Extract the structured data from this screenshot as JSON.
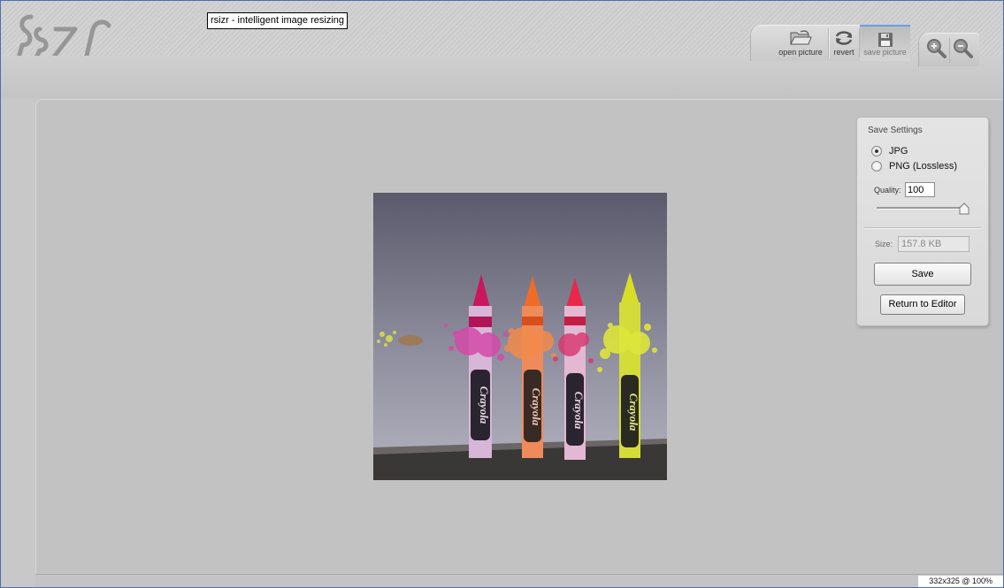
{
  "app": {
    "tooltip": "rsizr - intelligent image resizing",
    "logo_icon": "rszr-logo"
  },
  "toolbar": {
    "open_label": "open picture",
    "revert_label": "revert",
    "save_label": "save picture",
    "open_icon": "folder-open-icon",
    "revert_icon": "revert-icon",
    "save_icon": "floppy-disk-icon",
    "zoom_in_icon": "zoom-in-icon",
    "zoom_out_icon": "zoom-out-icon"
  },
  "save_panel": {
    "title": "Save Settings",
    "formats": [
      {
        "label": "JPG",
        "selected": true
      },
      {
        "label": "PNG (Lossless)",
        "selected": false
      }
    ],
    "quality_label": "Quality:",
    "quality_value": "100",
    "quality_slider_fraction": 1.0,
    "size_label": "Size:",
    "size_value": "157.8 KB",
    "save_button": "Save",
    "return_button": "Return to Editor"
  },
  "canvas": {
    "image_description_icon": "crayons-photo",
    "crayon_colors": [
      "#c8175d",
      "#f06a28",
      "#e8284a",
      "#d6de2a"
    ],
    "crayon_brand": "Crayola"
  },
  "status": {
    "text": "332x325 @ 100%"
  },
  "colors": {
    "accent": "#6a9ee0",
    "panel_bg": "#c2c2c2"
  }
}
